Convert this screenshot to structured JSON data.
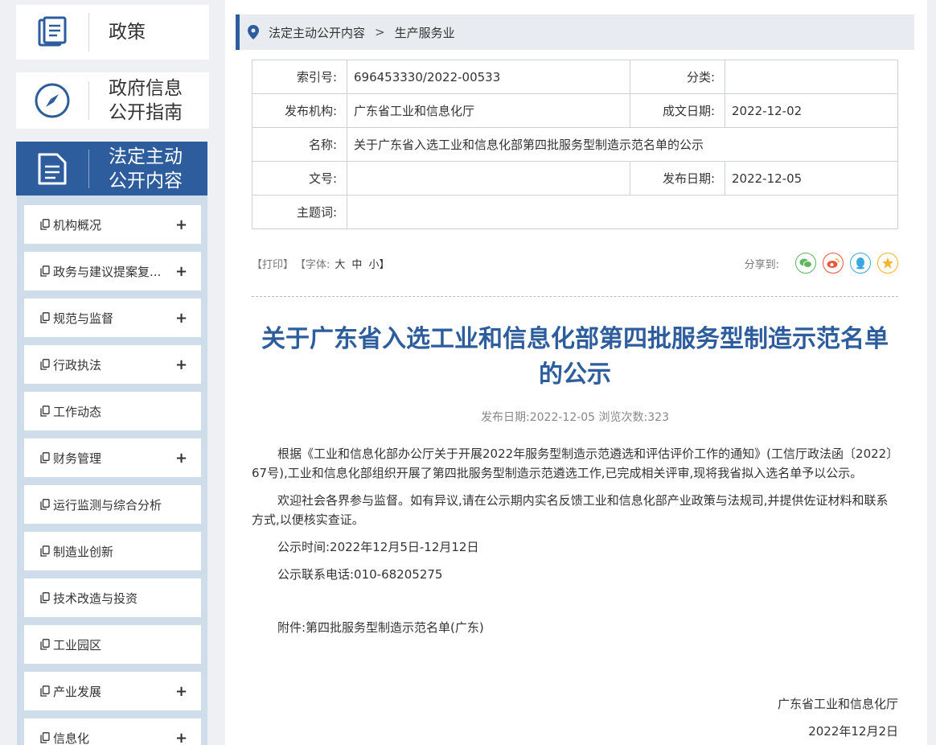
{
  "sidebar": {
    "policy": "政策",
    "guide_line1": "政府信息",
    "guide_line2": "公开指南",
    "legal_line1": "法定主动",
    "legal_line2": "公开内容",
    "items": [
      {
        "label": "机构概况",
        "expand": "+"
      },
      {
        "label": "政务与建议提案复...",
        "expand": "+"
      },
      {
        "label": "规范与监督",
        "expand": "+"
      },
      {
        "label": "行政执法",
        "expand": "+"
      },
      {
        "label": "工作动态",
        "expand": ""
      },
      {
        "label": "财务管理",
        "expand": "+"
      },
      {
        "label": "运行监测与综合分析",
        "expand": ""
      },
      {
        "label": "制造业创新",
        "expand": ""
      },
      {
        "label": "技术改造与投资",
        "expand": ""
      },
      {
        "label": "工业园区",
        "expand": ""
      },
      {
        "label": "产业发展",
        "expand": "+"
      },
      {
        "label": "信息化",
        "expand": "+"
      }
    ]
  },
  "breadcrumb": {
    "level1": "法定主动公开内容",
    "separator": ">",
    "level2": "生产服务业"
  },
  "meta": {
    "index_label": "索引号:",
    "index_value": "696453330/2022-00533",
    "category_label": "分类:",
    "category_value": "",
    "org_label": "发布机构:",
    "org_value": "广东省工业和信息化厅",
    "created_label": "成文日期:",
    "created_value": "2022-12-02",
    "name_label": "名称:",
    "name_value": "关于广东省入选工业和信息化部第四批服务型制造示范名单的公示",
    "docno_label": "文号:",
    "docno_value": "",
    "pub_label": "发布日期:",
    "pub_value": "2022-12-05",
    "keywords_label": "主题词:",
    "keywords_value": ""
  },
  "toolbar": {
    "print": "【打印】",
    "font_open": "【字体:",
    "font_big": "大",
    "font_mid": "中",
    "font_small": "小】",
    "share_label": "分享到:"
  },
  "article": {
    "title": "关于广东省入选工业和信息化部第四批服务型制造示范名单的公示",
    "pub_info": "发布日期:2022-12-05  浏览次数:323",
    "p1": "根据《工业和信息化部办公厅关于开展2022年服务型制造示范遴选和评估评价工作的通知》(工信厅政法函〔2022〕67号),工业和信息化部组织开展了第四批服务型制造示范遴选工作,已完成相关评审,现将我省拟入选名单予以公示。",
    "p2": "欢迎社会各界参与监督。如有异议,请在公示期内实名反馈工业和信息化部产业政策与法规司,并提供佐证材料和联系方式,以便核实查证。",
    "p3": "公示时间:2022年12月5日-12月12日",
    "p4": "公示联系电话:010-68205275",
    "p5": "附件:第四批服务型制造示范名单(广东)",
    "sign_org": "广东省工业和信息化厅",
    "sign_date": "2022年12月2日"
  },
  "colors": {
    "accent": "#2d5d9c",
    "wechat": "#5cb85c",
    "weibo": "#e8573f",
    "qq": "#3aa8e0",
    "qzone": "#f3b52a"
  }
}
